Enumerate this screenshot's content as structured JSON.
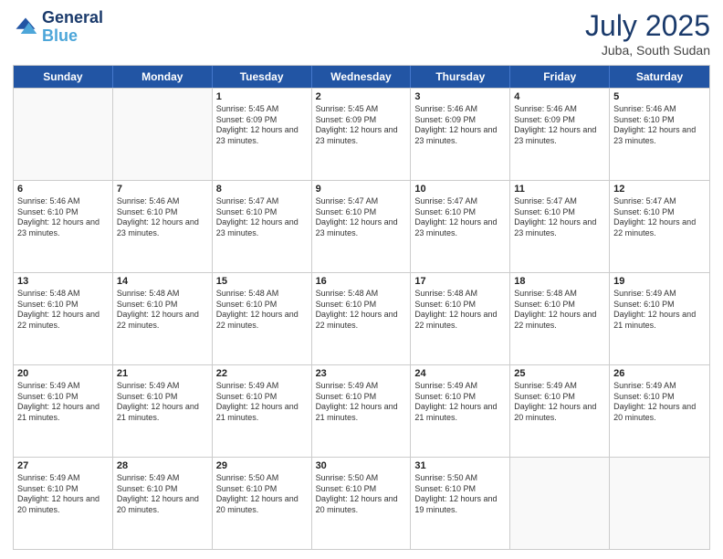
{
  "logo": {
    "line1": "General",
    "line2": "Blue"
  },
  "title": "July 2025",
  "location": "Juba, South Sudan",
  "days_header": [
    "Sunday",
    "Monday",
    "Tuesday",
    "Wednesday",
    "Thursday",
    "Friday",
    "Saturday"
  ],
  "weeks": [
    [
      {
        "day": "",
        "info": ""
      },
      {
        "day": "",
        "info": ""
      },
      {
        "day": "1",
        "info": "Sunrise: 5:45 AM\nSunset: 6:09 PM\nDaylight: 12 hours and 23 minutes."
      },
      {
        "day": "2",
        "info": "Sunrise: 5:45 AM\nSunset: 6:09 PM\nDaylight: 12 hours and 23 minutes."
      },
      {
        "day": "3",
        "info": "Sunrise: 5:46 AM\nSunset: 6:09 PM\nDaylight: 12 hours and 23 minutes."
      },
      {
        "day": "4",
        "info": "Sunrise: 5:46 AM\nSunset: 6:09 PM\nDaylight: 12 hours and 23 minutes."
      },
      {
        "day": "5",
        "info": "Sunrise: 5:46 AM\nSunset: 6:10 PM\nDaylight: 12 hours and 23 minutes."
      }
    ],
    [
      {
        "day": "6",
        "info": "Sunrise: 5:46 AM\nSunset: 6:10 PM\nDaylight: 12 hours and 23 minutes."
      },
      {
        "day": "7",
        "info": "Sunrise: 5:46 AM\nSunset: 6:10 PM\nDaylight: 12 hours and 23 minutes."
      },
      {
        "day": "8",
        "info": "Sunrise: 5:47 AM\nSunset: 6:10 PM\nDaylight: 12 hours and 23 minutes."
      },
      {
        "day": "9",
        "info": "Sunrise: 5:47 AM\nSunset: 6:10 PM\nDaylight: 12 hours and 23 minutes."
      },
      {
        "day": "10",
        "info": "Sunrise: 5:47 AM\nSunset: 6:10 PM\nDaylight: 12 hours and 23 minutes."
      },
      {
        "day": "11",
        "info": "Sunrise: 5:47 AM\nSunset: 6:10 PM\nDaylight: 12 hours and 23 minutes."
      },
      {
        "day": "12",
        "info": "Sunrise: 5:47 AM\nSunset: 6:10 PM\nDaylight: 12 hours and 22 minutes."
      }
    ],
    [
      {
        "day": "13",
        "info": "Sunrise: 5:48 AM\nSunset: 6:10 PM\nDaylight: 12 hours and 22 minutes."
      },
      {
        "day": "14",
        "info": "Sunrise: 5:48 AM\nSunset: 6:10 PM\nDaylight: 12 hours and 22 minutes."
      },
      {
        "day": "15",
        "info": "Sunrise: 5:48 AM\nSunset: 6:10 PM\nDaylight: 12 hours and 22 minutes."
      },
      {
        "day": "16",
        "info": "Sunrise: 5:48 AM\nSunset: 6:10 PM\nDaylight: 12 hours and 22 minutes."
      },
      {
        "day": "17",
        "info": "Sunrise: 5:48 AM\nSunset: 6:10 PM\nDaylight: 12 hours and 22 minutes."
      },
      {
        "day": "18",
        "info": "Sunrise: 5:48 AM\nSunset: 6:10 PM\nDaylight: 12 hours and 22 minutes."
      },
      {
        "day": "19",
        "info": "Sunrise: 5:49 AM\nSunset: 6:10 PM\nDaylight: 12 hours and 21 minutes."
      }
    ],
    [
      {
        "day": "20",
        "info": "Sunrise: 5:49 AM\nSunset: 6:10 PM\nDaylight: 12 hours and 21 minutes."
      },
      {
        "day": "21",
        "info": "Sunrise: 5:49 AM\nSunset: 6:10 PM\nDaylight: 12 hours and 21 minutes."
      },
      {
        "day": "22",
        "info": "Sunrise: 5:49 AM\nSunset: 6:10 PM\nDaylight: 12 hours and 21 minutes."
      },
      {
        "day": "23",
        "info": "Sunrise: 5:49 AM\nSunset: 6:10 PM\nDaylight: 12 hours and 21 minutes."
      },
      {
        "day": "24",
        "info": "Sunrise: 5:49 AM\nSunset: 6:10 PM\nDaylight: 12 hours and 21 minutes."
      },
      {
        "day": "25",
        "info": "Sunrise: 5:49 AM\nSunset: 6:10 PM\nDaylight: 12 hours and 20 minutes."
      },
      {
        "day": "26",
        "info": "Sunrise: 5:49 AM\nSunset: 6:10 PM\nDaylight: 12 hours and 20 minutes."
      }
    ],
    [
      {
        "day": "27",
        "info": "Sunrise: 5:49 AM\nSunset: 6:10 PM\nDaylight: 12 hours and 20 minutes."
      },
      {
        "day": "28",
        "info": "Sunrise: 5:49 AM\nSunset: 6:10 PM\nDaylight: 12 hours and 20 minutes."
      },
      {
        "day": "29",
        "info": "Sunrise: 5:50 AM\nSunset: 6:10 PM\nDaylight: 12 hours and 20 minutes."
      },
      {
        "day": "30",
        "info": "Sunrise: 5:50 AM\nSunset: 6:10 PM\nDaylight: 12 hours and 20 minutes."
      },
      {
        "day": "31",
        "info": "Sunrise: 5:50 AM\nSunset: 6:10 PM\nDaylight: 12 hours and 19 minutes."
      },
      {
        "day": "",
        "info": ""
      },
      {
        "day": "",
        "info": ""
      }
    ]
  ]
}
